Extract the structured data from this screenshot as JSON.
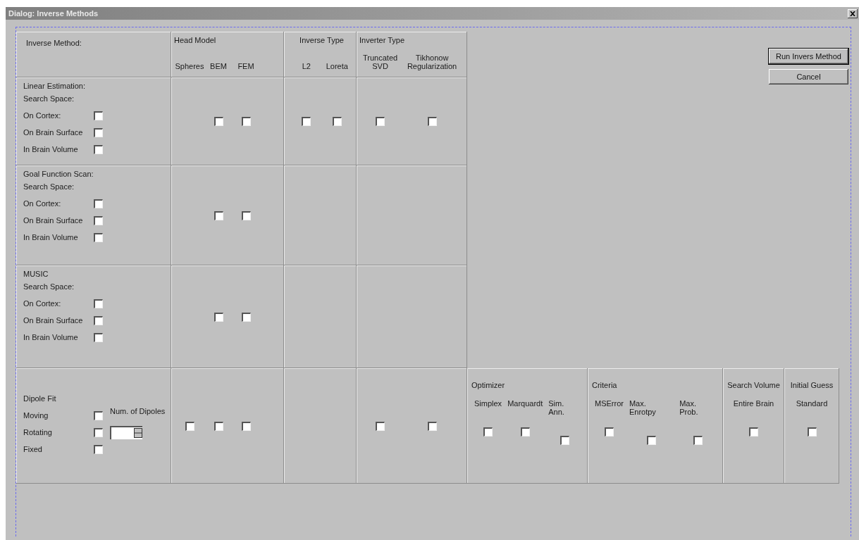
{
  "window": {
    "title": "Dialog: Inverse Methods"
  },
  "header": {
    "label": "Inverse Method:",
    "groups": [
      {
        "title": "Head Model",
        "options": [
          "Spheres",
          "BEM",
          "FEM"
        ]
      },
      {
        "title": "Inverse Type",
        "options": [
          "L2",
          "Loreta"
        ]
      },
      {
        "title": "Inverter Type",
        "options": [
          "Truncated SVD",
          "Tikhonow Regularization"
        ]
      }
    ]
  },
  "sections": [
    {
      "title": "Linear Estimation:",
      "subtitle": "Search Space:",
      "options": [
        {
          "label": "On Cortex:",
          "checked": false
        },
        {
          "label": "On Brain Surface",
          "checked": false
        },
        {
          "label": "In Brain Volume",
          "checked": false
        }
      ],
      "head_model": [
        {
          "checked": false
        },
        {
          "checked": false
        }
      ],
      "inverse_type": [
        {
          "checked": false
        },
        {
          "checked": false
        }
      ],
      "inverter_type": [
        {
          "checked": false
        },
        {
          "checked": false
        }
      ]
    },
    {
      "title": "Goal Function Scan:",
      "subtitle": "Search Space:",
      "options": [
        {
          "label": "On Cortex:",
          "checked": false
        },
        {
          "label": "On Brain Surface",
          "checked": false
        },
        {
          "label": "In Brain Volume",
          "checked": false
        }
      ],
      "head_model": [
        {
          "checked": false
        },
        {
          "checked": false
        }
      ]
    },
    {
      "title": "MUSIC",
      "subtitle": "Search Space:",
      "options": [
        {
          "label": "On Cortex:",
          "checked": false
        },
        {
          "label": "On Brain Surface",
          "checked": false
        },
        {
          "label": "In Brain Volume",
          "checked": false
        }
      ],
      "head_model": [
        {
          "checked": false
        },
        {
          "checked": false
        }
      ]
    },
    {
      "title": "Dipole Fit",
      "options": [
        {
          "label": "Moving",
          "checked": false
        },
        {
          "label": "Rotating",
          "checked": false
        },
        {
          "label": "Fixed",
          "checked": false
        }
      ],
      "num_dipoles": {
        "label": "Num. of Dipoles"
      },
      "head_model": [
        {
          "checked": false
        },
        {
          "checked": false
        },
        {
          "checked": false
        }
      ],
      "inverter_type": [
        {
          "checked": false
        },
        {
          "checked": false
        }
      ]
    }
  ],
  "panels": [
    {
      "title": "Optimizer",
      "options": [
        {
          "label": "Simplex",
          "checked": false
        },
        {
          "label": "Marquardt",
          "checked": false
        },
        {
          "label": "Sim. Ann.",
          "checked": false
        }
      ]
    },
    {
      "title": "Criteria",
      "options": [
        {
          "label": "MSError",
          "checked": false
        },
        {
          "label": "Max. Enrotpy",
          "checked": false
        },
        {
          "label": "Max. Prob.",
          "checked": false
        }
      ]
    },
    {
      "title": "Search Volume",
      "options": [
        {
          "label": "Entire Brain",
          "checked": false
        }
      ]
    },
    {
      "title": "Initial Guess",
      "options": [
        {
          "label": "Standard",
          "checked": false
        }
      ]
    }
  ],
  "buttons": [
    {
      "label": "Run Invers Method",
      "default": true
    },
    {
      "label": "Cancel",
      "default": false
    }
  ]
}
